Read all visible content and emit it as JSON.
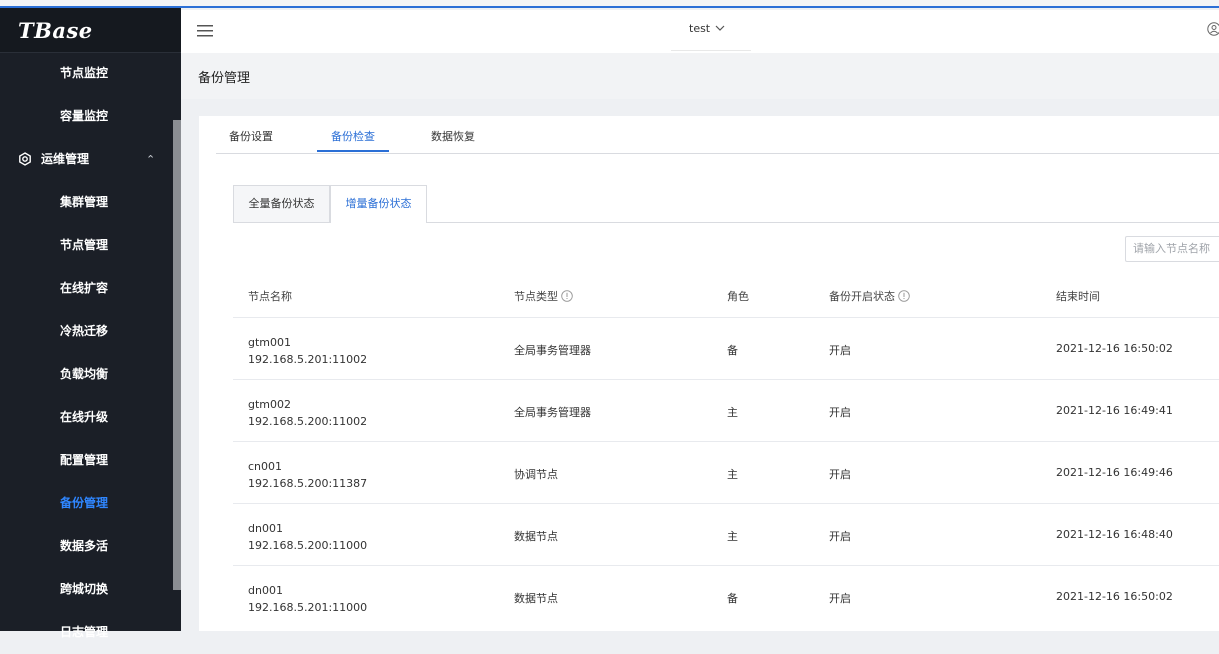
{
  "brand": "TBase",
  "sidebar": {
    "items": [
      {
        "label": "节点监控",
        "type": "item"
      },
      {
        "label": "容量监控",
        "type": "item"
      },
      {
        "label": "运维管理",
        "type": "group"
      },
      {
        "label": "集群管理",
        "type": "item"
      },
      {
        "label": "节点管理",
        "type": "item"
      },
      {
        "label": "在线扩容",
        "type": "item"
      },
      {
        "label": "冷热迁移",
        "type": "item"
      },
      {
        "label": "负载均衡",
        "type": "item"
      },
      {
        "label": "在线升级",
        "type": "item"
      },
      {
        "label": "配置管理",
        "type": "item"
      },
      {
        "label": "备份管理",
        "type": "item",
        "active": true
      },
      {
        "label": "数据多活",
        "type": "item"
      },
      {
        "label": "跨城切换",
        "type": "item"
      },
      {
        "label": "日志管理",
        "type": "item"
      }
    ]
  },
  "header": {
    "env": "test"
  },
  "page": {
    "title": "备份管理"
  },
  "tabs": [
    "备份设置",
    "备份检查",
    "数据恢复"
  ],
  "active_tab": "备份检查",
  "subtabs": [
    "全量备份状态",
    "增量备份状态"
  ],
  "active_subtab": "增量备份状态",
  "search": {
    "placeholder": "请输入节点名称"
  },
  "table": {
    "columns": [
      "节点名称",
      "节点类型",
      "角色",
      "备份开启状态",
      "结束时间"
    ],
    "rows": [
      {
        "name": "gtm001",
        "addr": "192.168.5.201:11002",
        "type": "全局事务管理器",
        "role": "备",
        "status": "开启",
        "end": "2021-12-16 16:50:02"
      },
      {
        "name": "gtm002",
        "addr": "192.168.5.200:11002",
        "type": "全局事务管理器",
        "role": "主",
        "status": "开启",
        "end": "2021-12-16 16:49:41"
      },
      {
        "name": "cn001",
        "addr": "192.168.5.200:11387",
        "type": "协调节点",
        "role": "主",
        "status": "开启",
        "end": "2021-12-16 16:49:46"
      },
      {
        "name": "dn001",
        "addr": "192.168.5.200:11000",
        "type": "数据节点",
        "role": "主",
        "status": "开启",
        "end": "2021-12-16 16:48:40"
      },
      {
        "name": "dn001",
        "addr": "192.168.5.201:11000",
        "type": "数据节点",
        "role": "备",
        "status": "开启",
        "end": "2021-12-16 16:50:02"
      }
    ]
  },
  "colors": {
    "accent": "#2b6fd6",
    "sidebar_bg": "#1b1f27",
    "active_nav": "#2f86ff"
  }
}
